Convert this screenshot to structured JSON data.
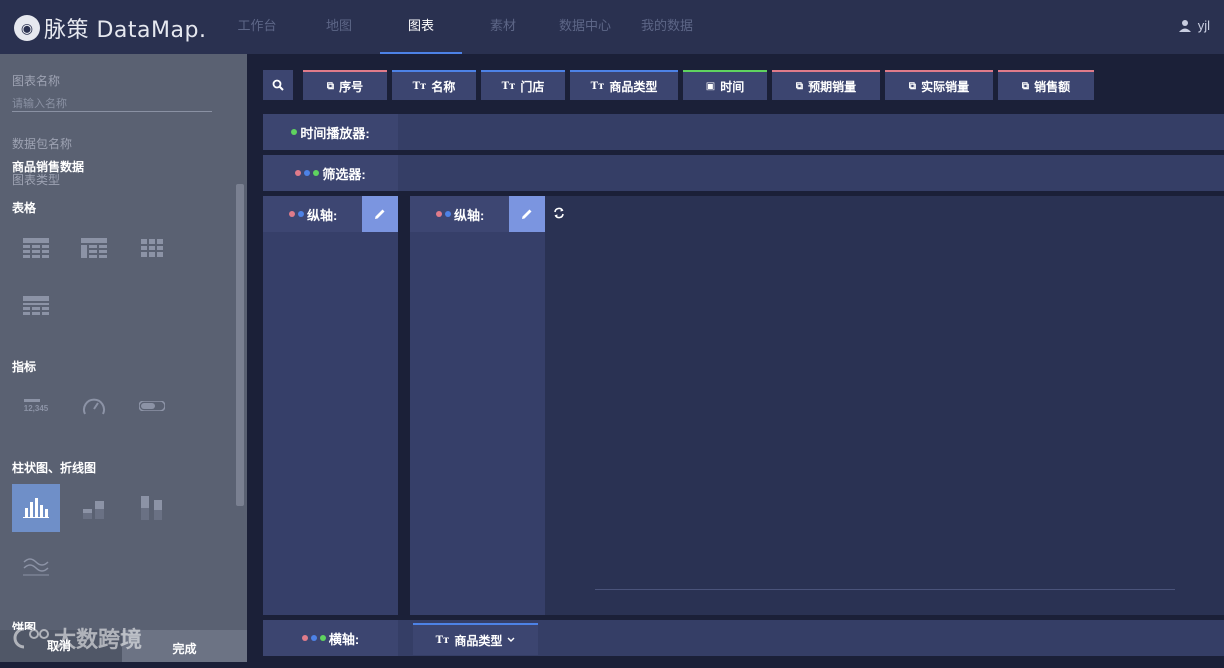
{
  "brand": {
    "name": "脉策 DataMap."
  },
  "nav": [
    {
      "label": "工作台",
      "active": false
    },
    {
      "label": "地图",
      "active": false
    },
    {
      "label": "图表",
      "active": true
    },
    {
      "label": "素材",
      "active": false
    },
    {
      "label": "数据中心",
      "active": false
    },
    {
      "label": "我的数据",
      "active": false
    }
  ],
  "user": {
    "name": "yjl"
  },
  "sidebar": {
    "chart_name_label": "图表名称",
    "chart_name_placeholder": "请输入名称",
    "dataset_label": "数据包名称",
    "dataset_value": "商品销售数据",
    "chart_type_label": "图表类型",
    "sections": {
      "table": "表格",
      "indicator": "指标",
      "bar_line": "柱状图、折线图",
      "pie": "饼图"
    },
    "indicator_number": "12,345",
    "cancel": "取消",
    "done": "完成",
    "watermark": "太数跨境"
  },
  "fields": [
    {
      "label": "序号",
      "type": "number",
      "color": "#e07b8a"
    },
    {
      "label": "名称",
      "type": "text",
      "color": "#4d82e6"
    },
    {
      "label": "门店",
      "type": "text",
      "color": "#4d82e6"
    },
    {
      "label": "商品类型",
      "type": "text",
      "color": "#4d82e6"
    },
    {
      "label": "时间",
      "type": "date",
      "color": "#5fd35f"
    },
    {
      "label": "预期销量",
      "type": "number",
      "color": "#e07b8a"
    },
    {
      "label": "实际销量",
      "type": "number",
      "color": "#e07b8a"
    },
    {
      "label": "销售额",
      "type": "number",
      "color": "#e07b8a"
    }
  ],
  "rows": {
    "time_player": "时间播放器:",
    "filter": "筛选器:",
    "y_axis_1": "纵轴:",
    "y_axis_2": "纵轴:",
    "x_axis": "横轴:",
    "x_axis_chip": "商品类型"
  },
  "colors": {
    "red_dot": "#e07b8a",
    "blue_dot": "#4d82e6",
    "green_dot": "#5fd35f",
    "accent": "#4d82e6"
  }
}
